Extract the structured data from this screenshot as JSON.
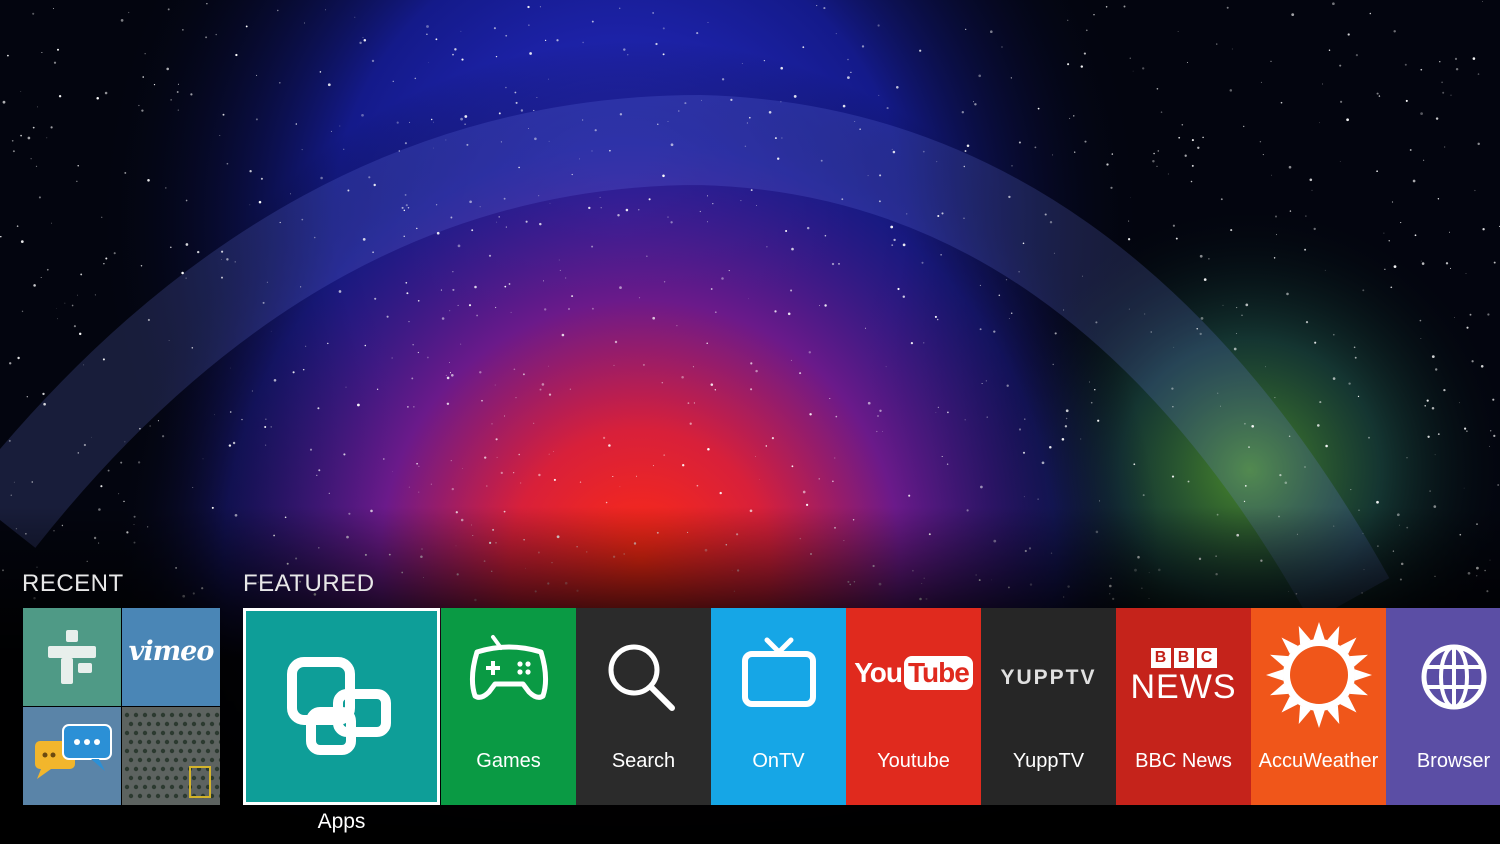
{
  "sections": {
    "recent": "RECENT",
    "featured": "FEATURED"
  },
  "recent_items": {
    "vimeo": "vimeo",
    "icons": [
      "tunein-icon",
      "vimeo-logo",
      "chat-bubbles-icon",
      "photo-thumbnail"
    ]
  },
  "featured": [
    {
      "key": "apps",
      "label": "Apps",
      "color": "#0e9e98",
      "icon": "apps-icon"
    },
    {
      "key": "games",
      "label": "Games",
      "color": "#0a9a44",
      "icon": "gamepad-icon"
    },
    {
      "key": "search",
      "label": "Search",
      "color": "#2b2b2b",
      "icon": "search-icon"
    },
    {
      "key": "ontv",
      "label": "OnTV",
      "color": "#16a6e6",
      "icon": "tv-icon"
    },
    {
      "key": "youtube",
      "label": "Youtube",
      "color": "#e02a1e",
      "icon": "youtube-logo"
    },
    {
      "key": "yupptv",
      "label": "YuppTV",
      "color": "#262626",
      "icon": "yupptv-logo"
    },
    {
      "key": "bbc",
      "label": "BBC News",
      "color": "#c5231b",
      "icon": "bbc-news-logo"
    },
    {
      "key": "accuweather",
      "label": "AccuWeather",
      "color": "#f0561a",
      "icon": "sun-icon"
    },
    {
      "key": "browser",
      "label": "Browser",
      "color": "#5b4ea5",
      "icon": "globe-icon"
    }
  ],
  "logos": {
    "youtube_you": "You",
    "youtube_tube": "Tube",
    "yupptv": "YUPPTV",
    "bbc_letters": [
      "B",
      "B",
      "C"
    ],
    "bbc_news": "NEWS"
  }
}
